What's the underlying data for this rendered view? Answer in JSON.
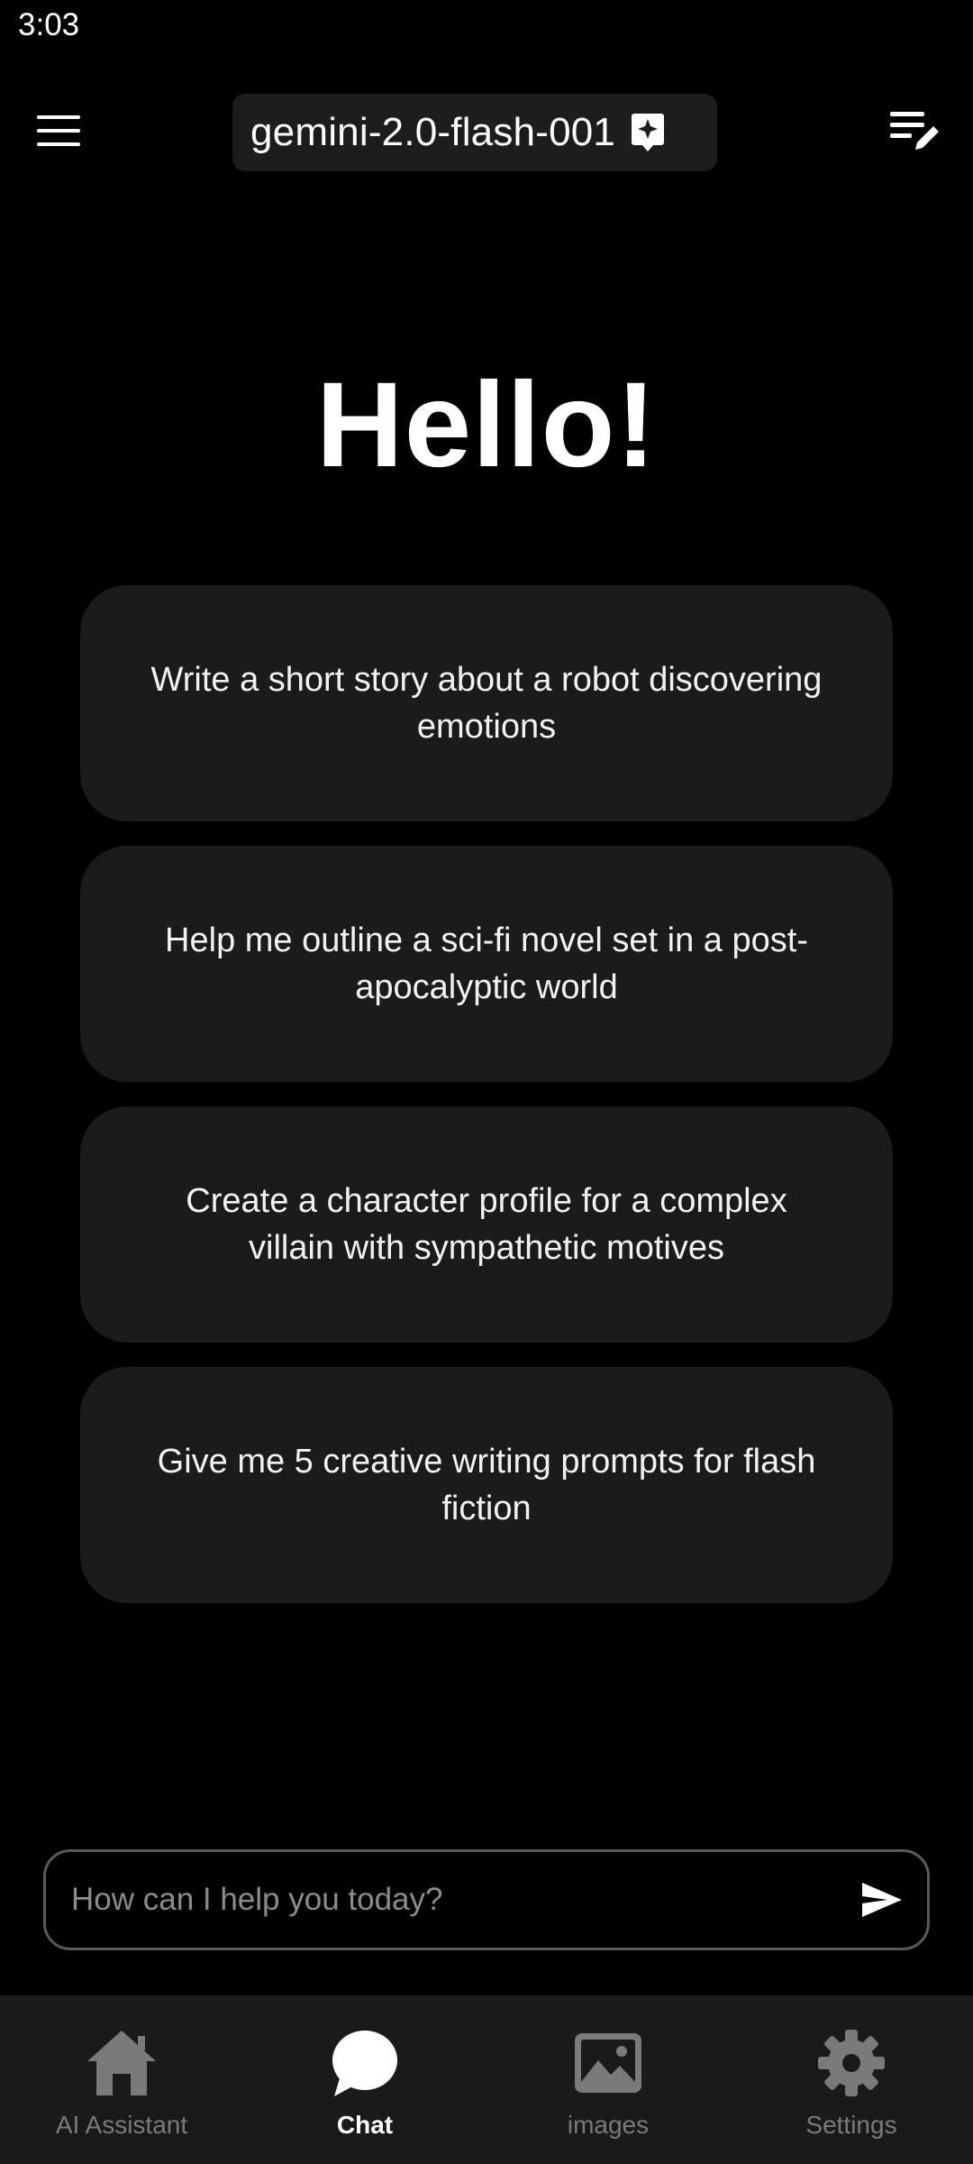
{
  "status_bar": {
    "time": "3:03"
  },
  "header": {
    "model_name": "gemini-2.0-flash-001",
    "icons": {
      "menu": "hamburger-menu-icon",
      "model": "sparkle-badge-icon",
      "new_chat": "edit-list-icon"
    }
  },
  "main": {
    "greeting": "Hello!",
    "suggestions": [
      {
        "text": "Write a short story about a robot discovering emotions"
      },
      {
        "text": "Help me outline a sci-fi novel set in a post-apocalyptic world"
      },
      {
        "text": "Create a character profile for a complex villain with sympathetic motives"
      },
      {
        "text": "Give me 5 creative writing prompts for flash fiction"
      }
    ]
  },
  "input": {
    "placeholder": "How can I help you today?",
    "value": "",
    "send_icon": "send-icon"
  },
  "bottom_nav": {
    "items": [
      {
        "label": "AI Assistant",
        "icon": "home-icon",
        "active": false
      },
      {
        "label": "Chat",
        "icon": "chat-bubble-icon",
        "active": true
      },
      {
        "label": "images",
        "icon": "image-icon",
        "active": false
      },
      {
        "label": "Settings",
        "icon": "gear-icon",
        "active": false
      }
    ]
  },
  "colors": {
    "background": "#000000",
    "card": "#1b1b1b",
    "nav_background": "#1a1a1a",
    "inactive": "#7a7a7a",
    "active": "#ffffff"
  }
}
